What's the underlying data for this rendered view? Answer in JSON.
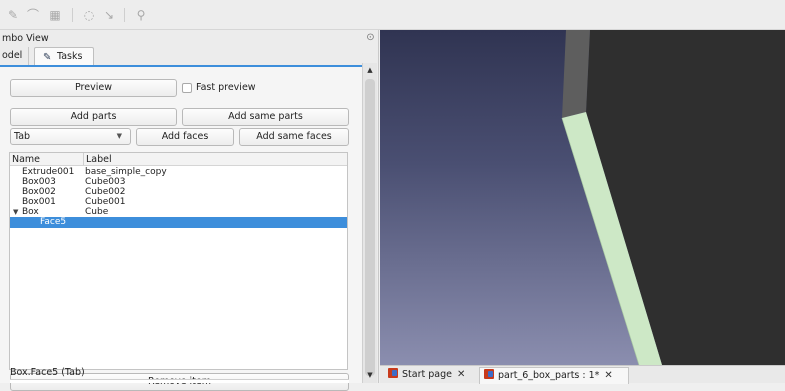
{
  "toolbar": {
    "icons": [
      "pencil-icon",
      "bridge-icon",
      "grid-icon",
      "refresh-icon",
      "curve-icon",
      "constraint-icon"
    ]
  },
  "combo_view": {
    "title": "mbo View",
    "float_icon": "⊙",
    "tabs": {
      "model": "odel",
      "tasks": "Tasks"
    }
  },
  "task_panel": {
    "preview_button": "Preview",
    "fast_preview_label": "Fast preview",
    "fast_preview_checked": false,
    "add_parts_button": "Add parts",
    "add_same_parts_button": "Add same parts",
    "joint_type_select": "Tab",
    "add_faces_button": "Add faces",
    "add_same_faces_button": "Add same faces",
    "tree": {
      "headers": {
        "name": "Name",
        "label": "Label"
      },
      "rows": [
        {
          "name": "Extrude001",
          "label": "base_simple_copy"
        },
        {
          "name": "Box003",
          "label": "Cube003"
        },
        {
          "name": "Box002",
          "label": "Cube002"
        },
        {
          "name": "Box001",
          "label": "Cube001"
        },
        {
          "name": "Box",
          "label": "Cube",
          "expanded": true
        },
        {
          "name": "Face5",
          "label": "",
          "selected": true
        }
      ]
    },
    "remove_item_button": "Remove item",
    "status_text": "Box.Face5 (Tab)"
  },
  "document_tabs": [
    {
      "label": "Start page",
      "close": "✕"
    },
    {
      "label": "part_6_box_parts : 1*",
      "close": "✕",
      "active": true
    }
  ],
  "colors": {
    "accent": "#3d8edb",
    "viewport_top": "#303452",
    "viewport_bottom": "#8b8eaf",
    "selected_face": "#cde8c6",
    "solid_face": "#2f2f2f",
    "solid_edge": "#5e5e5e"
  }
}
